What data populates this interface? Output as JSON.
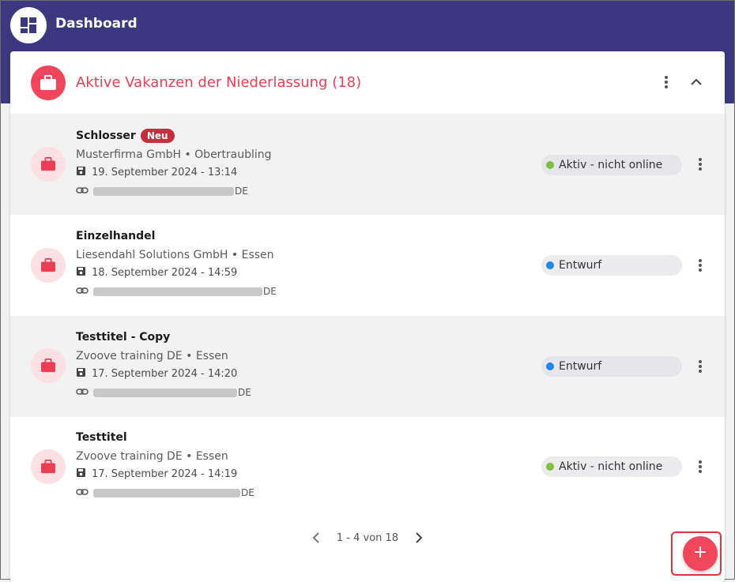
{
  "app": {
    "title": "Dashboard"
  },
  "card": {
    "title": "Aktive Vakanzen der Niederlassung (18)"
  },
  "vacancies": [
    {
      "title": "Schlosser",
      "badge": "Neu",
      "company": "Musterfirma GmbH • Obertraubling",
      "date": "19. September 2024 - 13:14",
      "link_suffix": "DE",
      "status": "Aktiv - nicht online",
      "status_color": "#7cc142"
    },
    {
      "title": "Einzelhandel",
      "badge": "",
      "company": "Liesendahl Solutions GmbH • Essen",
      "date": "18. September 2024 - 14:59",
      "link_suffix": "DE",
      "status": "Entwurf",
      "status_color": "#1e88e5"
    },
    {
      "title": "Testtitel - Copy",
      "badge": "",
      "company": "Zvoove training DE  • Essen",
      "date": "17. September 2024 - 14:20",
      "link_suffix": "DE",
      "status": "Entwurf",
      "status_color": "#1e88e5"
    },
    {
      "title": "Testtitel",
      "badge": "",
      "company": "Zvoove training DE  • Essen",
      "date": "17. September 2024 - 14:19",
      "link_suffix": "DE",
      "status": "Aktiv - nicht online",
      "status_color": "#7cc142"
    }
  ],
  "pagination": {
    "info": "1 - 4 von 18"
  },
  "colors": {
    "topbar": "#3c3880",
    "accent": "#f0465c",
    "title_red": "#e93e55"
  },
  "icons": {
    "logo": "dashboard-icon",
    "header": "briefcase-icon",
    "row": "briefcase-icon",
    "date": "save-icon",
    "link": "link-icon",
    "more": "more-vert-icon",
    "collapse": "chevron-up-icon",
    "prev": "chevron-left-icon",
    "next": "chevron-right-icon",
    "fab": "plus-icon"
  }
}
